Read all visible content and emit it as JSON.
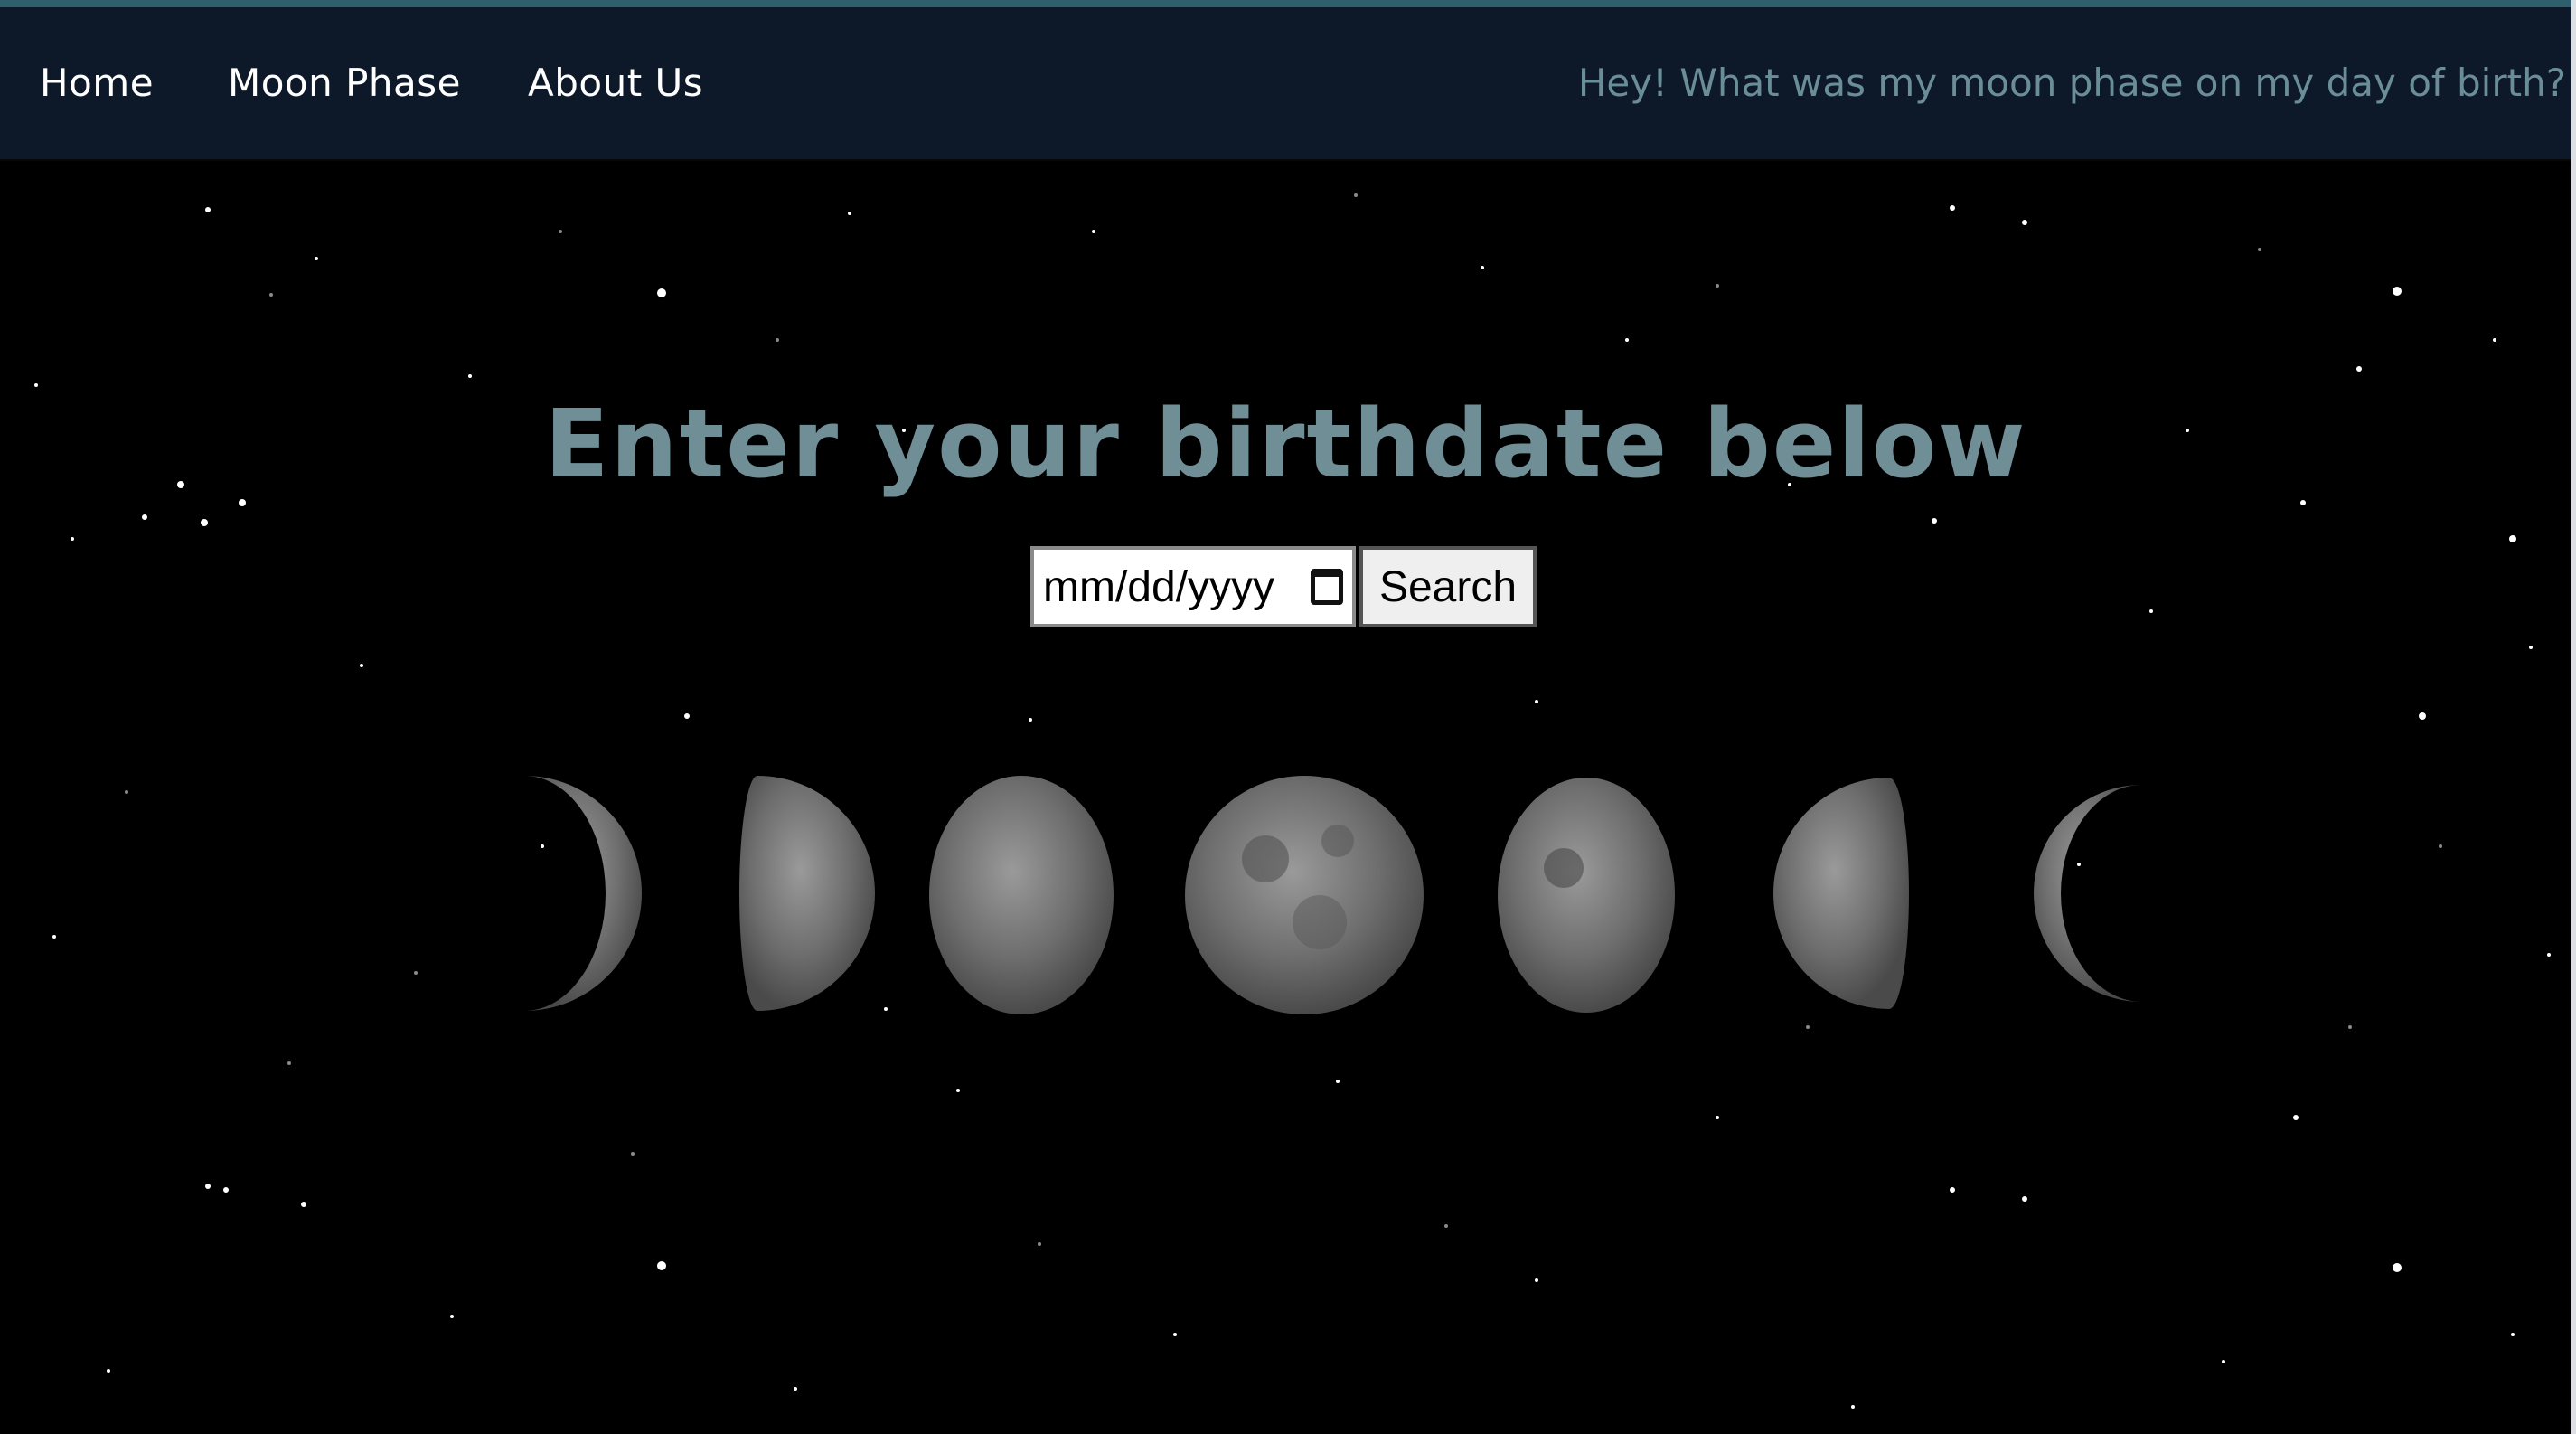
{
  "nav": {
    "home": "Home",
    "moon_phase": "Moon Phase",
    "about": "About Us",
    "tagline": "Hey! What was my moon phase on my day of birth?"
  },
  "main": {
    "heading": "Enter your birthdate below",
    "date_placeholder": "mm/dd/yyyy",
    "search_label": "Search"
  },
  "colors": {
    "nav_bg": "#0d1829",
    "heading": "#6f8e96",
    "tagline": "#6a8e98"
  },
  "moon_phases": [
    "waxing-crescent",
    "first-quarter",
    "waxing-gibbous",
    "full-moon",
    "waning-gibbous",
    "last-quarter",
    "waning-crescent"
  ]
}
